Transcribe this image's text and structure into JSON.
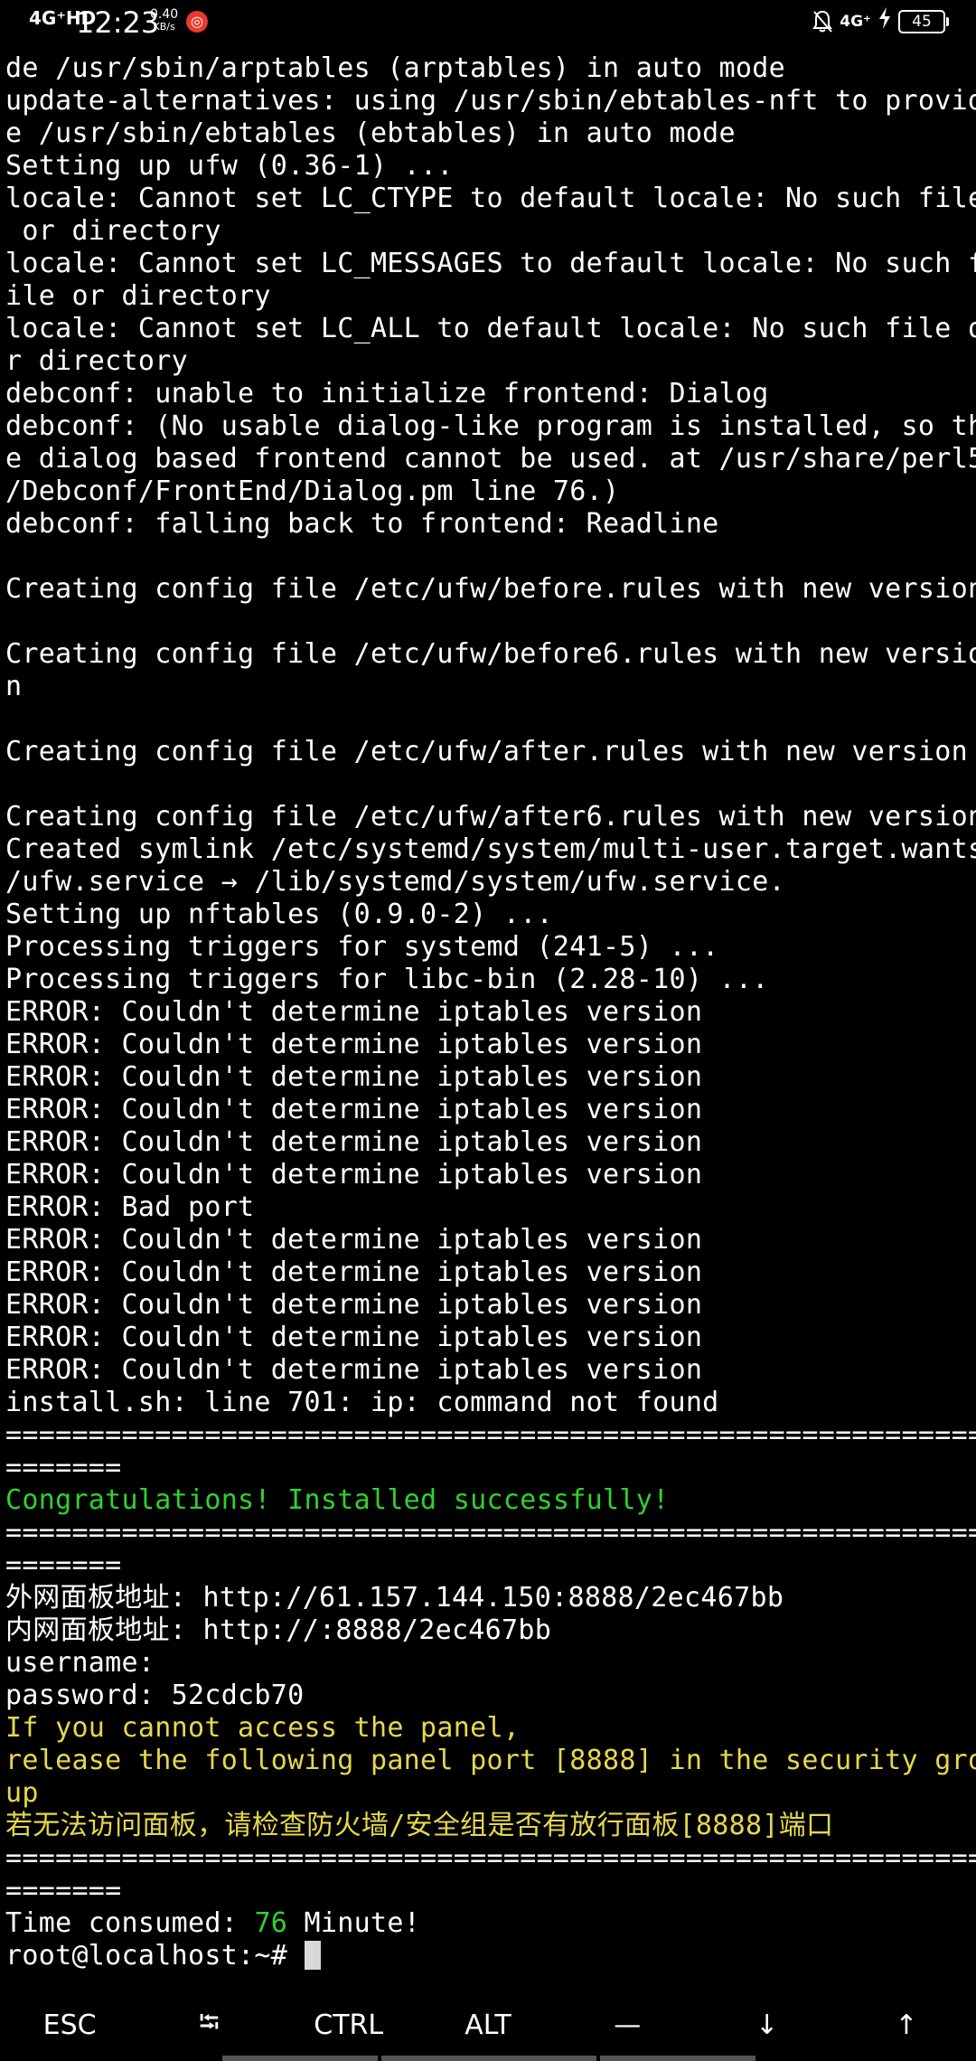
{
  "status_bar": {
    "signal_left": "4G⁺HD",
    "time": "12:23",
    "net_speed_value": "0.40",
    "net_speed_unit": "KB/s",
    "app_icon": "weibo-icon",
    "right_network": "4G⁺",
    "battery_level": "45",
    "icons": [
      "mute-bell-icon",
      "signal-icon",
      "charging-icon",
      "battery-icon"
    ]
  },
  "terminal": {
    "colors": {
      "default": "#ffffff",
      "success": "#2ed22e",
      "warning": "#e6d84a"
    },
    "lines": [
      {
        "text": "de /usr/sbin/arptables (arptables) in auto mode",
        "color": "white"
      },
      {
        "text": "update-alternatives: using /usr/sbin/ebtables-nft to provid",
        "color": "white"
      },
      {
        "text": "e /usr/sbin/ebtables (ebtables) in auto mode",
        "color": "white"
      },
      {
        "text": "Setting up ufw (0.36-1) ...",
        "color": "white"
      },
      {
        "text": "locale: Cannot set LC_CTYPE to default locale: No such file",
        "color": "white"
      },
      {
        "text": " or directory",
        "color": "white"
      },
      {
        "text": "locale: Cannot set LC_MESSAGES to default locale: No such f",
        "color": "white"
      },
      {
        "text": "ile or directory",
        "color": "white"
      },
      {
        "text": "locale: Cannot set LC_ALL to default locale: No such file o",
        "color": "white"
      },
      {
        "text": "r directory",
        "color": "white"
      },
      {
        "text": "debconf: unable to initialize frontend: Dialog",
        "color": "white"
      },
      {
        "text": "debconf: (No usable dialog-like program is installed, so th",
        "color": "white"
      },
      {
        "text": "e dialog based frontend cannot be used. at /usr/share/perl5",
        "color": "white"
      },
      {
        "text": "/Debconf/FrontEnd/Dialog.pm line 76.)",
        "color": "white"
      },
      {
        "text": "debconf: falling back to frontend: Readline",
        "color": "white"
      },
      {
        "text": "",
        "color": "white"
      },
      {
        "text": "Creating config file /etc/ufw/before.rules with new version",
        "color": "white"
      },
      {
        "text": "",
        "color": "white"
      },
      {
        "text": "Creating config file /etc/ufw/before6.rules with new versio",
        "color": "white"
      },
      {
        "text": "n",
        "color": "white"
      },
      {
        "text": "",
        "color": "white"
      },
      {
        "text": "Creating config file /etc/ufw/after.rules with new version",
        "color": "white"
      },
      {
        "text": "",
        "color": "white"
      },
      {
        "text": "Creating config file /etc/ufw/after6.rules with new version",
        "color": "white"
      },
      {
        "text": "Created symlink /etc/systemd/system/multi-user.target.wants",
        "color": "white"
      },
      {
        "text": "/ufw.service → /lib/systemd/system/ufw.service.",
        "color": "white"
      },
      {
        "text": "Setting up nftables (0.9.0-2) ...",
        "color": "white"
      },
      {
        "text": "Processing triggers for systemd (241-5) ...",
        "color": "white"
      },
      {
        "text": "Processing triggers for libc-bin (2.28-10) ...",
        "color": "white"
      },
      {
        "text": "ERROR: Couldn't determine iptables version",
        "color": "white"
      },
      {
        "text": "ERROR: Couldn't determine iptables version",
        "color": "white"
      },
      {
        "text": "ERROR: Couldn't determine iptables version",
        "color": "white"
      },
      {
        "text": "ERROR: Couldn't determine iptables version",
        "color": "white"
      },
      {
        "text": "ERROR: Couldn't determine iptables version",
        "color": "white"
      },
      {
        "text": "ERROR: Couldn't determine iptables version",
        "color": "white"
      },
      {
        "text": "ERROR: Bad port",
        "color": "white"
      },
      {
        "text": "ERROR: Couldn't determine iptables version",
        "color": "white"
      },
      {
        "text": "ERROR: Couldn't determine iptables version",
        "color": "white"
      },
      {
        "text": "ERROR: Couldn't determine iptables version",
        "color": "white"
      },
      {
        "text": "ERROR: Couldn't determine iptables version",
        "color": "white"
      },
      {
        "text": "ERROR: Couldn't determine iptables version",
        "color": "white"
      },
      {
        "text": "install.sh: line 701: ip: command not found",
        "color": "white"
      },
      {
        "text": "============================================================",
        "color": "white"
      },
      {
        "text": "=======",
        "color": "white"
      },
      {
        "text": "Congratulations! Installed successfully!",
        "color": "green"
      },
      {
        "text": "============================================================",
        "color": "white"
      },
      {
        "text": "=======",
        "color": "white"
      },
      {
        "text": "外网面板地址: http://61.157.144.150:8888/2ec467bb",
        "color": "white"
      },
      {
        "text": "内网面板地址: http://:8888/2ec467bb",
        "color": "white"
      },
      {
        "text": "username:",
        "color": "white"
      },
      {
        "text": "password: 52cdcb70",
        "color": "white"
      },
      {
        "text": "If you cannot access the panel,",
        "color": "yellow"
      },
      {
        "text": "release the following panel port [8888] in the security gro",
        "color": "yellow"
      },
      {
        "text": "up",
        "color": "yellow"
      },
      {
        "text": "若无法访问面板，请检查防火墙/安全组是否有放行面板[8888]端口",
        "color": "yellow"
      },
      {
        "text": "============================================================",
        "color": "white"
      },
      {
        "text": "=======",
        "color": "white"
      }
    ],
    "time_consumed": {
      "prefix": "Time consumed: ",
      "value": "76",
      "suffix": " Minute!"
    },
    "prompt": "root@localhost:~# "
  },
  "extra_keys": [
    {
      "label": "ESC",
      "name": "esc-key"
    },
    {
      "label": "⭾",
      "name": "tab-key"
    },
    {
      "label": "CTRL",
      "name": "ctrl-key"
    },
    {
      "label": "ALT",
      "name": "alt-key"
    },
    {
      "label": "—",
      "name": "dash-key"
    },
    {
      "label": "↓",
      "name": "arrow-down-key"
    },
    {
      "label": "↑",
      "name": "arrow-up-key"
    }
  ]
}
